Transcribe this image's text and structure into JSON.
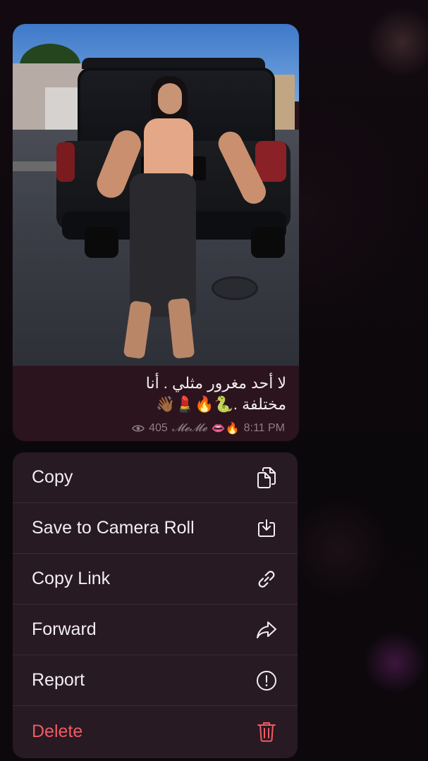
{
  "message": {
    "caption_line1": "لا أحد مغرور مثلي . أنا",
    "caption_line2": "مختلفة .🐍🔥💄👋🏾",
    "views": "405",
    "author": "𝓜𝓮𝓜𝓮",
    "author_emoji": "👄🔥",
    "time": "8:11 PM"
  },
  "menu": {
    "items": [
      {
        "label": "Copy",
        "icon": "copy-icon"
      },
      {
        "label": "Save to Camera Roll",
        "icon": "download-icon"
      },
      {
        "label": "Copy Link",
        "icon": "link-icon"
      },
      {
        "label": "Forward",
        "icon": "forward-icon"
      },
      {
        "label": "Report",
        "icon": "exclamation-circle-icon"
      },
      {
        "label": "Delete",
        "icon": "trash-icon"
      }
    ]
  },
  "colors": {
    "menu_bg": "#271a22",
    "danger": "#f05a66",
    "bubble_bg": "#2b141e"
  }
}
